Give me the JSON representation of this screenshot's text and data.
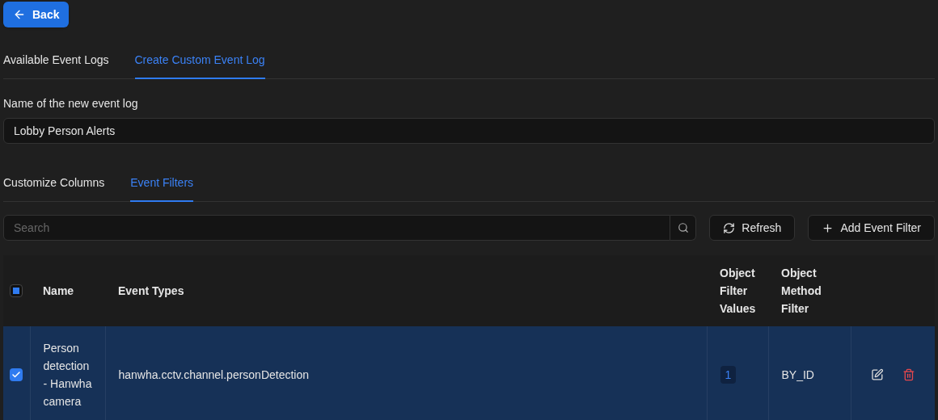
{
  "back_button": {
    "label": "Back"
  },
  "tabs": [
    {
      "label": "Available Event Logs",
      "selected": false
    },
    {
      "label": "Create Custom Event Log",
      "selected": true
    }
  ],
  "name_field": {
    "label": "Name of the new event log",
    "value": "Lobby Person Alerts"
  },
  "sub_tabs": [
    {
      "label": "Customize Columns",
      "selected": false
    },
    {
      "label": "Event Filters",
      "selected": true
    }
  ],
  "search": {
    "placeholder": "Search"
  },
  "toolbar_buttons": [
    {
      "kind": "refresh",
      "label": "Refresh"
    },
    {
      "kind": "add",
      "label": "Add Event Filter"
    }
  ],
  "table": {
    "select_all": {
      "partial": true
    },
    "columns": [
      "Name",
      "Event Types",
      "Object Filter Values",
      "Object Method Filter"
    ],
    "rows": [
      {
        "selected": true,
        "name": "Person detection - Hanwha camera",
        "event_types": "hanwha.cctv.channel.personDetection",
        "object_filter_values": "1",
        "object_method_filter": "BY_ID"
      }
    ]
  }
}
